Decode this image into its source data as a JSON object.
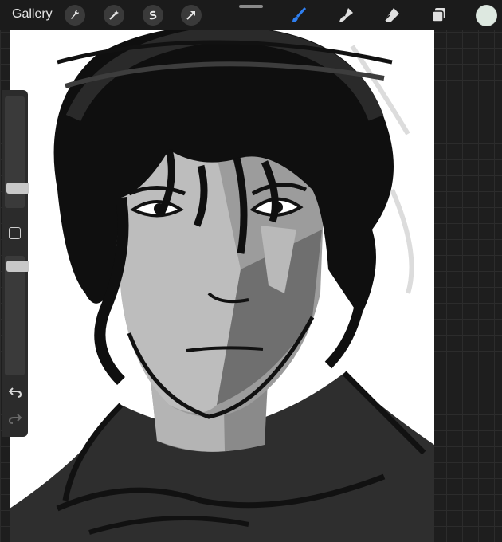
{
  "toolbar": {
    "gallery_label": "Gallery",
    "actions": [
      "wrench-icon",
      "magic-wand-icon",
      "selection-icon",
      "transform-arrow-icon"
    ],
    "tools": [
      "brush-icon",
      "smudge-icon",
      "eraser-icon",
      "layers-icon"
    ],
    "active_tool": "brush",
    "active_color": "#dde8e0",
    "accent_color": "#2f7ff0"
  },
  "sidebar": {
    "brush_size_level": 0.78,
    "opacity_level": 0.1,
    "controls": [
      "modifier-square",
      "undo-icon",
      "redo-icon"
    ]
  }
}
